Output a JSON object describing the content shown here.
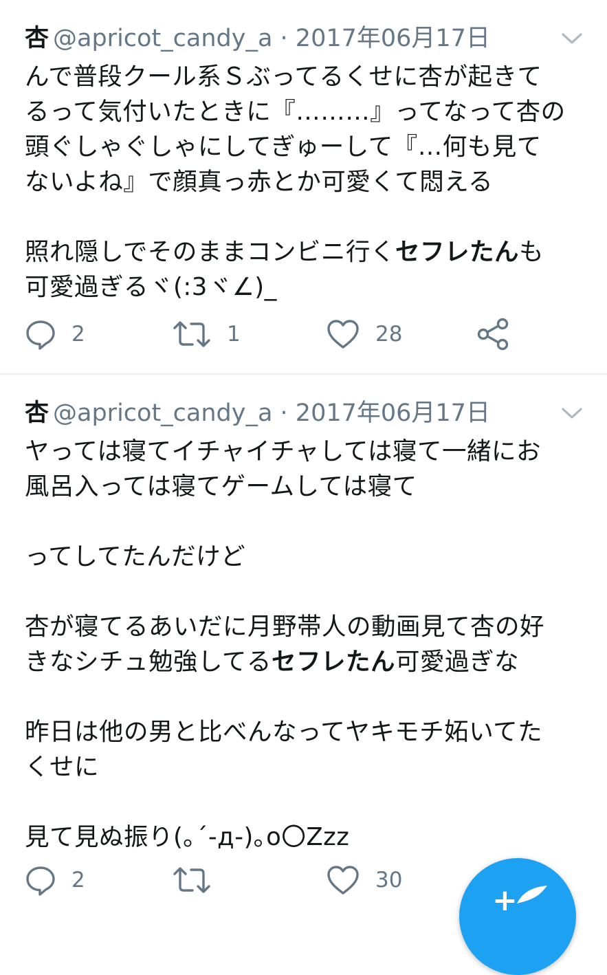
{
  "tweets": [
    {
      "name": "杏",
      "meta": "@apricot_candy_a · 2017年06月17日",
      "body": [
        {
          "text": "んで普段クール系Ｓぶってるくせに杏が起きて\nるって気付いたときに『………』ってなって杏の\n頭ぐしゃぐしゃにしてぎゅーして『…何も見て\nないよね』で顔真っ赤とか可愛くて悶える\n\n照れ隠しでそのままコンビニ行く"
        },
        {
          "text": "セフレたん",
          "bold": true
        },
        {
          "text": "も\n可愛過ぎるヾ(:3ヾ∠)_"
        }
      ],
      "actions": {
        "replies": "2",
        "retweets": "1",
        "likes": "28"
      },
      "icons": [
        "reply-icon",
        "retweet-icon",
        "like-icon",
        "share-icon"
      ]
    },
    {
      "name": "杏",
      "meta": "@apricot_candy_a · 2017年06月17日",
      "body": [
        {
          "text": "ヤっては寝てイチャイチャしては寝て一緒にお\n風呂入っては寝てゲームしては寝て\n\nってしてたんだけど\n\n杏が寝てるあいだに月野帯人の動画見て杏の好\nきなシチュ勉強してる"
        },
        {
          "text": "セフレたん",
          "bold": true
        },
        {
          "text": "可愛過ぎな\n\n昨日は他の男と比べんなってヤキモチ妬いてた\nくせに\n\n見て見ぬ振り(｡´-д-)｡o〇Zzz"
        }
      ],
      "actions": {
        "replies": "2",
        "retweets": "",
        "likes": "30"
      },
      "icons": [
        "reply-icon",
        "retweet-icon",
        "like-icon"
      ]
    }
  ],
  "fab": {
    "label": "+",
    "color": "#1da1f2",
    "icon": "compose-feather-icon"
  },
  "colors": {
    "text": "#14171a",
    "secondary": "#657786",
    "divider": "#e6ecf0",
    "accent": "#1da1f2"
  }
}
